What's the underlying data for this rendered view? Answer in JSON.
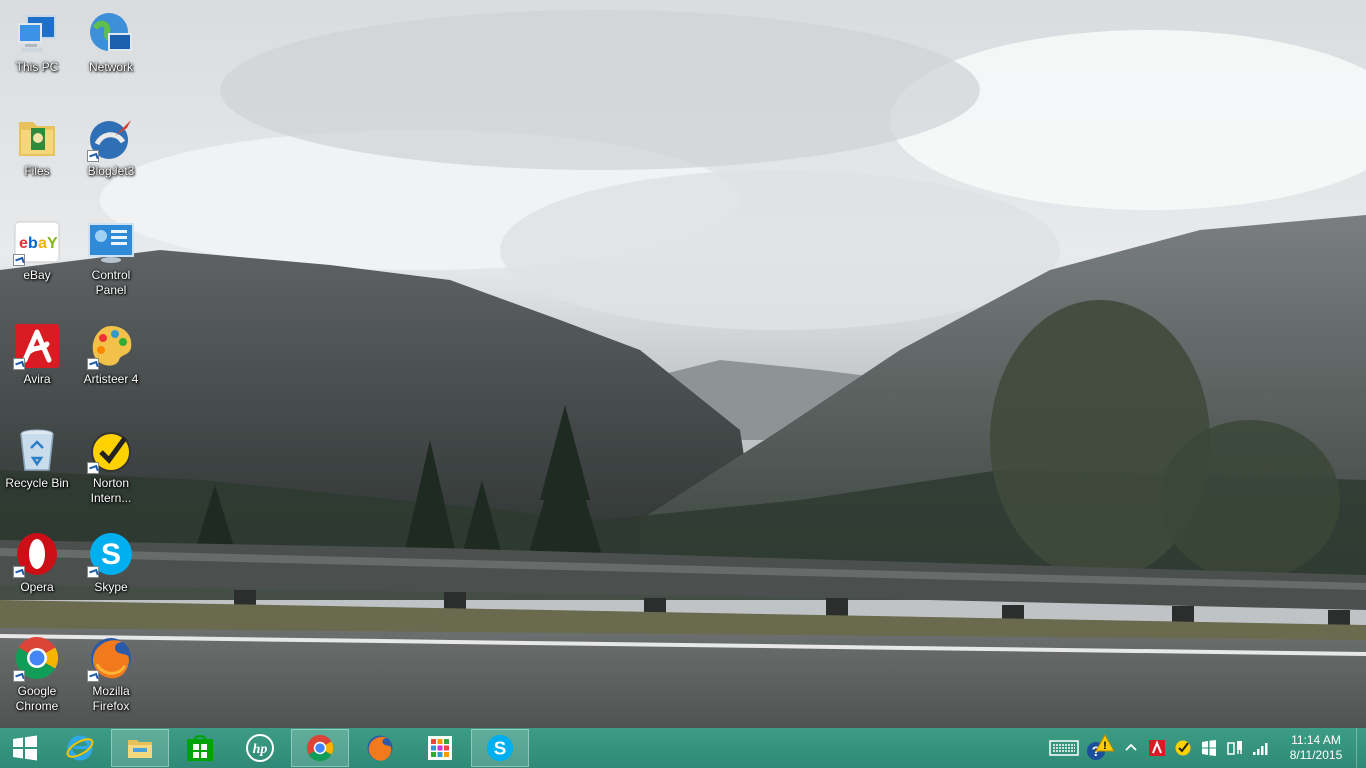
{
  "desktop_icons": [
    {
      "id": "this-pc",
      "label": "This PC",
      "icon": "computer-icon",
      "shortcut": false
    },
    {
      "id": "network",
      "label": "Network",
      "icon": "network-icon",
      "shortcut": false
    },
    {
      "id": "files",
      "label": "Files",
      "icon": "folder-icon",
      "shortcut": false
    },
    {
      "id": "blogjet",
      "label": "BlogJet3",
      "icon": "blogjet-icon",
      "shortcut": true
    },
    {
      "id": "ebay",
      "label": "eBay",
      "icon": "ebay-icon",
      "shortcut": true
    },
    {
      "id": "control-panel",
      "label": "Control Panel",
      "icon": "control-panel-icon",
      "shortcut": false
    },
    {
      "id": "avira",
      "label": "Avira",
      "icon": "avira-icon",
      "shortcut": true
    },
    {
      "id": "artisteer",
      "label": "Artisteer 4",
      "icon": "palette-icon",
      "shortcut": true
    },
    {
      "id": "recycle-bin",
      "label": "Recycle Bin",
      "icon": "recycle-bin-icon",
      "shortcut": false
    },
    {
      "id": "norton",
      "label": "Norton Intern...",
      "icon": "norton-icon",
      "shortcut": true
    },
    {
      "id": "opera",
      "label": "Opera",
      "icon": "opera-icon",
      "shortcut": true
    },
    {
      "id": "skype",
      "label": "Skype",
      "icon": "skype-icon",
      "shortcut": true
    },
    {
      "id": "chrome",
      "label": "Google Chrome",
      "icon": "chrome-icon",
      "shortcut": true
    },
    {
      "id": "firefox",
      "label": "Mozilla Firefox",
      "icon": "firefox-icon",
      "shortcut": true
    }
  ],
  "taskbar": {
    "pinned": [
      {
        "id": "start",
        "icon": "windows-logo-icon"
      },
      {
        "id": "ie",
        "icon": "internet-explorer-icon"
      },
      {
        "id": "explorer",
        "icon": "file-explorer-icon"
      },
      {
        "id": "store",
        "icon": "store-icon"
      },
      {
        "id": "hp",
        "icon": "hp-icon"
      },
      {
        "id": "chrome",
        "icon": "chrome-icon"
      },
      {
        "id": "firefox",
        "icon": "firefox-icon"
      },
      {
        "id": "apps",
        "icon": "apps-grid-icon"
      },
      {
        "id": "skype",
        "icon": "skype-icon"
      }
    ],
    "tray": {
      "icons": [
        "touch-keyboard-icon",
        "action-center-icon",
        "show-hidden-icons-icon",
        "avira-tray-icon",
        "norton-tray-icon",
        "windows-flag-icon",
        "power-icon",
        "signal-icon"
      ],
      "time": "11:14 AM",
      "date": "8/11/2015"
    }
  },
  "colors": {
    "taskbar": "#2e8a76",
    "icon_text": "#ffffff"
  }
}
